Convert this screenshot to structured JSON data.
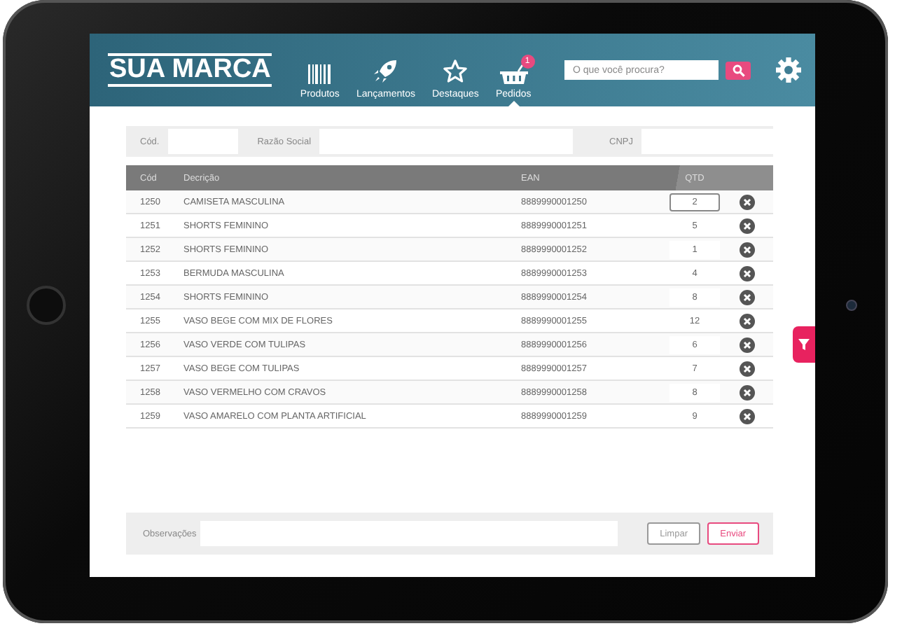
{
  "brand": {
    "logo": "SUA MARCA"
  },
  "nav": [
    {
      "label": "Produtos",
      "kind": "barcode",
      "selected": false
    },
    {
      "label": "Lançamentos",
      "kind": "rocket",
      "selected": false
    },
    {
      "label": "Destaques",
      "kind": "star",
      "selected": false
    },
    {
      "label": "Pedidos",
      "kind": "basket",
      "selected": true,
      "badge": "1"
    }
  ],
  "search": {
    "placeholder": "O que você procura?"
  },
  "filters": [
    {
      "label": "Cód."
    },
    {
      "label": "Razão Social"
    },
    {
      "label": "CNPJ"
    }
  ],
  "table": {
    "columns": [
      "Cód",
      "Decrição",
      "EAN",
      "QTD"
    ],
    "rows": [
      {
        "code": "1250",
        "description": "CAMISETA MASCULINA",
        "ean": "8889990001250",
        "qty": "2",
        "focused": true
      },
      {
        "code": "1251",
        "description": "SHORTS FEMININO",
        "ean": "8889990001251",
        "qty": "5",
        "focused": false
      },
      {
        "code": "1252",
        "description": "SHORTS FEMININO",
        "ean": "8889990001252",
        "qty": "1",
        "focused": false
      },
      {
        "code": "1253",
        "description": "BERMUDA MASCULINA",
        "ean": "8889990001253",
        "qty": "4",
        "focused": false
      },
      {
        "code": "1254",
        "description": "SHORTS FEMININO",
        "ean": "8889990001254",
        "qty": "8",
        "focused": false
      },
      {
        "code": "1255",
        "description": "VASO BEGE COM MIX DE FLORES",
        "ean": "8889990001255",
        "qty": "12",
        "focused": false
      },
      {
        "code": "1256",
        "description": "VASO VERDE COM TULIPAS",
        "ean": "8889990001256",
        "qty": "6",
        "focused": false
      },
      {
        "code": "1257",
        "description": "VASO BEGE COM TULIPAS",
        "ean": "8889990001257",
        "qty": "7",
        "focused": false
      },
      {
        "code": "1258",
        "description": "VASO VERMELHO COM CRAVOS",
        "ean": "8889990001258",
        "qty": "8",
        "focused": false
      },
      {
        "code": "1259",
        "description": "VASO AMARELO COM PLANTA ARTIFICIAL",
        "ean": "8889990001259",
        "qty": "9",
        "focused": false
      }
    ]
  },
  "footer": {
    "label": "Observações",
    "buttons": [
      {
        "label": "Limpar",
        "kind": "secondary"
      },
      {
        "label": "Enviar",
        "kind": "primary"
      }
    ]
  }
}
